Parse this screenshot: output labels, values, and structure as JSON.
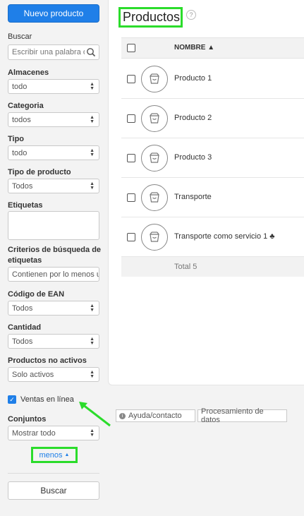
{
  "sidebar": {
    "new_button": "Nuevo producto",
    "search_label": "Buscar",
    "search_placeholder": "Escribir una palabra o",
    "filters": [
      {
        "label": "Almacenes",
        "value": "todo"
      },
      {
        "label": "Categoria",
        "value": "todos"
      },
      {
        "label": "Tipo",
        "value": "todo"
      },
      {
        "label": "Tipo de producto",
        "value": "Todos"
      }
    ],
    "tags_label": "Etiquetas",
    "tag_criteria_label_1": "Criterios de búsqueda de",
    "tag_criteria_label_2": "etiquetas",
    "tag_criteria_value": "Contienen por lo menos u",
    "ean_label": "Código de EAN",
    "ean_value": "Todos",
    "quantity_label": "Cantidad",
    "quantity_value": "Todos",
    "inactive_label": "Productos no activos",
    "inactive_value": "Solo activos",
    "online_sales_label": "Ventas en línea",
    "sets_label": "Conjuntos",
    "sets_value": "Mostrar todo",
    "less_link": "menos",
    "search_button": "Buscar"
  },
  "main": {
    "title": "Productos",
    "help": "?",
    "column_name": "NOMBRE ▲",
    "products": [
      {
        "name": "Producto 1"
      },
      {
        "name": "Producto 2"
      },
      {
        "name": "Producto 3"
      },
      {
        "name": "Transporte"
      },
      {
        "name": "Transporte como servicio 1 ♣"
      }
    ],
    "total": "Total 5"
  },
  "footer": {
    "help_contact": "Ayuda/contacto",
    "data_processing": "Procesamiento de datos"
  },
  "colors": {
    "accent": "#1f7fe8",
    "highlight": "#2bdc2b"
  }
}
